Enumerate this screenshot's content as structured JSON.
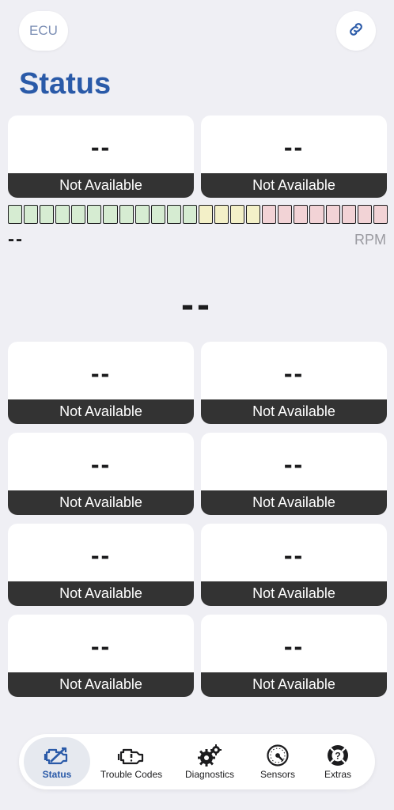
{
  "header": {
    "ecu_label": "ECU",
    "title": "Status"
  },
  "top_cards": [
    {
      "value": "--",
      "status": "Not Available"
    },
    {
      "value": "--",
      "status": "Not Available"
    }
  ],
  "rpm": {
    "value": "--",
    "unit": "RPM",
    "segments": {
      "green": 12,
      "yellow": 4,
      "red": 8,
      "colors": {
        "green": "#d6ecd2",
        "yellow": "#f3f0c8",
        "red": "#f2d3d6"
      }
    }
  },
  "speed": {
    "value": "--"
  },
  "grid_cards": [
    {
      "value": "--",
      "status": "Not Available"
    },
    {
      "value": "--",
      "status": "Not Available"
    },
    {
      "value": "--",
      "status": "Not Available"
    },
    {
      "value": "--",
      "status": "Not Available"
    },
    {
      "value": "--",
      "status": "Not Available"
    },
    {
      "value": "--",
      "status": "Not Available"
    },
    {
      "value": "--",
      "status": "Not Available"
    },
    {
      "value": "--",
      "status": "Not Available"
    }
  ],
  "tabs": [
    {
      "label": "Status",
      "icon": "engine-check-icon",
      "active": true
    },
    {
      "label": "Trouble Codes",
      "icon": "engine-warning-icon",
      "active": false
    },
    {
      "label": "Diagnostics",
      "icon": "gears-icon",
      "active": false
    },
    {
      "label": "Sensors",
      "icon": "gauge-icon",
      "active": false
    },
    {
      "label": "Extras",
      "icon": "lifebuoy-question-icon",
      "active": false
    }
  ],
  "colors": {
    "accent": "#2a5aa8",
    "background": "#efeff4",
    "card_footer": "#333333"
  }
}
